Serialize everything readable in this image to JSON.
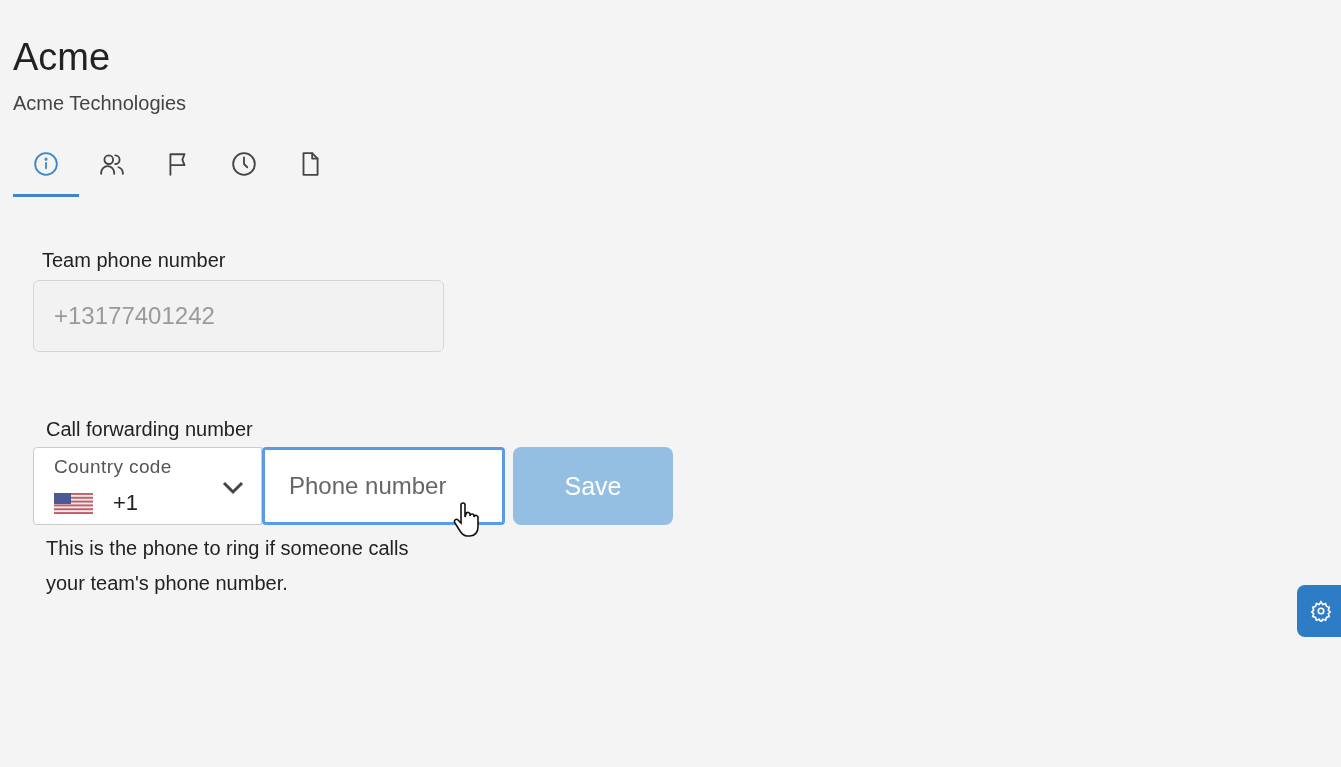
{
  "header": {
    "title": "Acme",
    "subtitle": "Acme Technologies"
  },
  "tabs": [
    {
      "kind": "info",
      "selected": true
    },
    {
      "kind": "people",
      "selected": false
    },
    {
      "kind": "flag",
      "selected": false
    },
    {
      "kind": "clock",
      "selected": false
    },
    {
      "kind": "file",
      "selected": false
    }
  ],
  "team_phone": {
    "label": "Team phone number",
    "value": "+13177401242",
    "disabled": true
  },
  "forwarding": {
    "label": "Call forwarding number",
    "country_label": "Country code",
    "country_value": "+1",
    "phone_placeholder": "Phone number",
    "phone_focused": true,
    "save": {
      "label": "Save",
      "disabled": true
    },
    "help": "This is the phone to ring if someone calls your team's phone number."
  }
}
